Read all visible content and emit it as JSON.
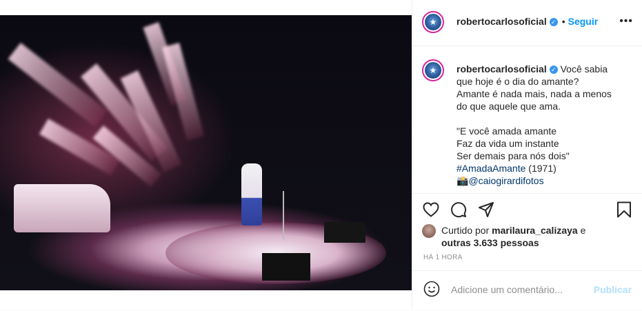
{
  "header": {
    "username": "robertocarlosoficial",
    "separator": "•",
    "follow_label": "Seguir",
    "more_label": "•••"
  },
  "caption": {
    "username": "robertocarlosoficial",
    "lines": [
      "Você sabia",
      "que hoje é o dia do amante?",
      "Amante é nada mais, nada a menos",
      "do que aquele que ama.",
      "",
      "\"E você amada amante",
      "Faz da vida um instante",
      "Ser demais para nós dois\""
    ],
    "hashtag": "#AmadaAmante",
    "year": " (1971)",
    "camera_emoji": "📸",
    "mention": "@caiogirardifotos"
  },
  "likes": {
    "prefix": "Curtido por ",
    "liker": "marilaura_calizaya",
    "conj": " e",
    "others": "outras 3.633 pessoas"
  },
  "timestamp": "HÁ 1 HORA",
  "comment": {
    "placeholder": "Adicione um comentário...",
    "publish_label": "Publicar"
  },
  "colors": {
    "accent": "#0095f6",
    "publish_disabled": "#b2dffc",
    "verified": "#3897f0"
  },
  "icons": [
    "heart-icon",
    "comment-icon",
    "share-icon",
    "bookmark-icon",
    "emoji-icon",
    "verified-badge-icon",
    "more-options-icon"
  ]
}
